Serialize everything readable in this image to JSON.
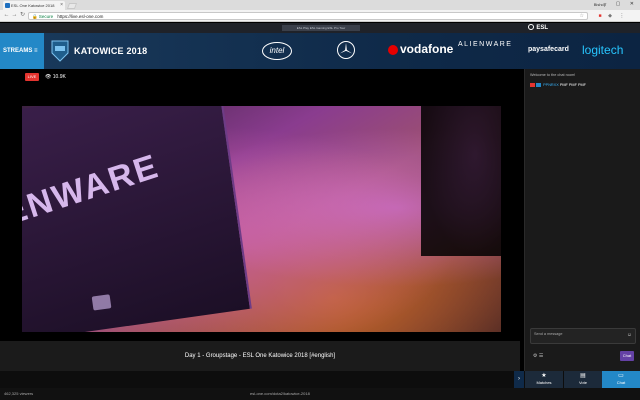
{
  "browser": {
    "tab_title": "ESL One Katowice 2018",
    "user_name": "Bishop",
    "secure_label": "Secure",
    "url": "https://live.esl-one.com",
    "window_controls": "– ▢ ✕"
  },
  "esl_topbar": {
    "center_text": "ESL Play  ESL Gaming  ESL Pro Tour",
    "brand": "ESL"
  },
  "header": {
    "streams_label": "STREAMS ≡",
    "event_title": "KATOWICE 2018",
    "sponsors": {
      "intel": "intel",
      "vodafone": "vodafone",
      "alienware": "ALIENWARE",
      "paysafecard": "paysafecard",
      "logitech": "logitech"
    }
  },
  "stream": {
    "live_label": "LIVE",
    "viewer_count": "10.9K",
    "overlay_text": "ENWARE",
    "title": "Day 1 - Groupstage - ESL One Katowice 2018 [#english]"
  },
  "chat": {
    "welcome": "Welcome to the chat room!",
    "messages": [
      {
        "user": "PPNRXX",
        "text": "PMF PMF PMF"
      }
    ],
    "input_placeholder": "Send a message",
    "send_label": "Chat"
  },
  "bottom_tabs": [
    {
      "label": "Matches",
      "icon": "star-icon"
    },
    {
      "label": "Vote",
      "icon": "vote-icon"
    },
    {
      "label": "Chat",
      "icon": "chat-icon",
      "active": true
    }
  ],
  "statusbar": {
    "left": "462,325 viewers",
    "center": "esl-one.com/dota2/katowice-2018"
  },
  "colors": {
    "streams_blue": "#2388C7",
    "live_red": "#E3342F",
    "header_navy": "#0F2A49",
    "chat_send_purple": "#6441A5"
  }
}
